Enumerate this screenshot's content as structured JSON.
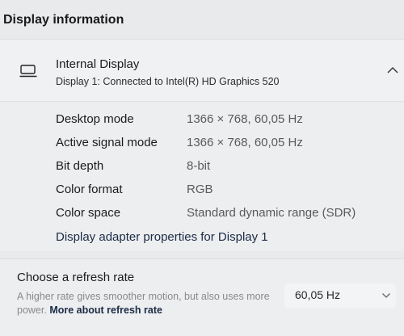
{
  "section_title": "Display information",
  "display": {
    "name": "Internal Display",
    "subtitle": "Display 1: Connected to Intel(R) HD Graphics 520",
    "icon": "monitor-icon",
    "expanded_icon": "chevron-up-icon"
  },
  "info_rows": [
    {
      "label": "Desktop mode",
      "value": "1366 × 768, 60,05 Hz"
    },
    {
      "label": "Active signal mode",
      "value": "1366 × 768, 60,05 Hz"
    },
    {
      "label": "Bit depth",
      "value": "8-bit"
    },
    {
      "label": "Color format",
      "value": "RGB"
    },
    {
      "label": "Color space",
      "value": "Standard dynamic range (SDR)"
    }
  ],
  "adapter_link": "Display adapter properties for Display 1",
  "refresh": {
    "title": "Choose a refresh rate",
    "description": "A higher rate gives smoother motion, but also uses more power.",
    "link": "More about refresh rate",
    "selected_rate": "60,05 Hz",
    "dropdown_icon": "chevron-down-icon"
  }
}
